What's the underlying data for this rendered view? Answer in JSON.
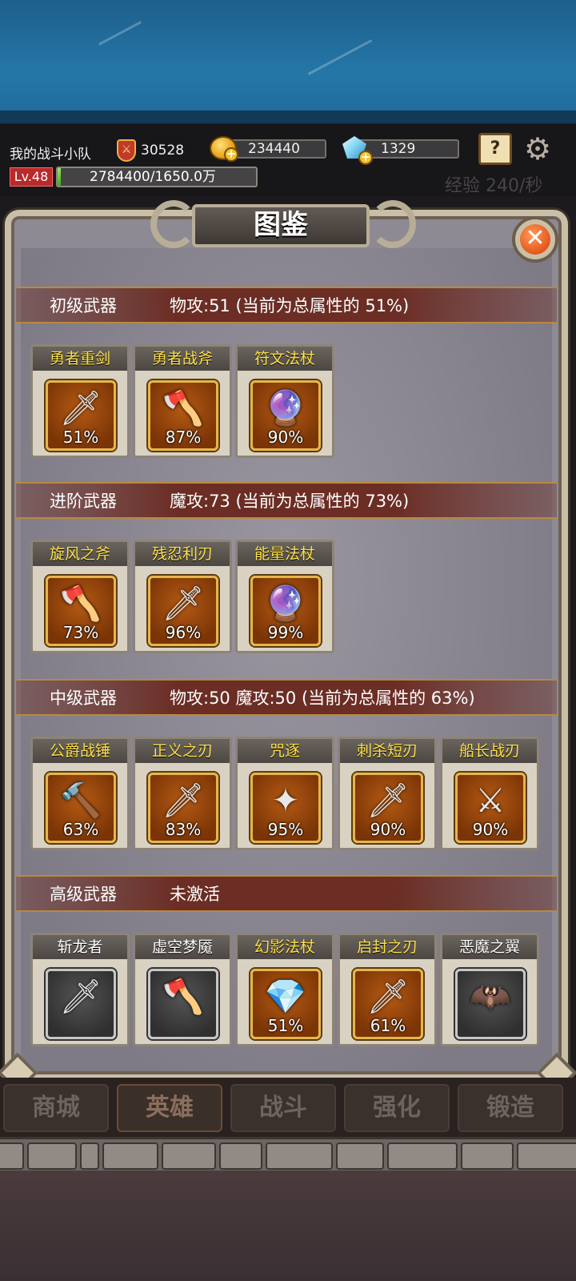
{
  "header": {
    "team_name": "我的战斗小队",
    "power": "30528",
    "gold": "234440",
    "diamonds": "1329",
    "level": "Lv.48",
    "xp_text": "2784400/1650.0万",
    "xp_fill_fraction": 0.017,
    "xp_rate": "经验 240/秒",
    "icons": {
      "power": "sword-shield-icon",
      "gold": "gold-coin-icon",
      "diamond": "diamond-icon",
      "guide": "help-book-icon",
      "settings": "gear-icon"
    }
  },
  "panel": {
    "title": "图鉴",
    "close_icon": "close-icon",
    "sections": [
      {
        "name": "初级武器",
        "stat": "物攻:51 (当前为总属性的 51%)",
        "items": [
          {
            "label": "勇者重剑",
            "pct": "51%",
            "icon": "greatsword-icon",
            "glyph": "🗡"
          },
          {
            "label": "勇者战斧",
            "pct": "87%",
            "icon": "battle-axe-icon",
            "glyph": "🪓"
          },
          {
            "label": "符文法杖",
            "pct": "90%",
            "icon": "rune-staff-icon",
            "glyph": "🔮"
          }
        ]
      },
      {
        "name": "进阶武器",
        "stat": "魔攻:73 (当前为总属性的 73%)",
        "items": [
          {
            "label": "旋风之斧",
            "pct": "73%",
            "icon": "whirlwind-axe-icon",
            "glyph": "🪓"
          },
          {
            "label": "残忍利刃",
            "pct": "96%",
            "icon": "cruel-blade-icon",
            "glyph": "🗡"
          },
          {
            "label": "能量法杖",
            "pct": "99%",
            "icon": "energy-staff-icon",
            "glyph": "🔮"
          }
        ]
      },
      {
        "name": "中级武器",
        "stat": "物攻:50  魔攻:50 (当前为总属性的 63%)",
        "items": [
          {
            "label": "公爵战锤",
            "pct": "63%",
            "icon": "war-hammer-icon",
            "glyph": "🔨"
          },
          {
            "label": "正义之刃",
            "pct": "83%",
            "icon": "justice-blade-icon",
            "glyph": "🗡"
          },
          {
            "label": "咒逐",
            "pct": "95%",
            "icon": "curse-staff-icon",
            "glyph": "✦"
          },
          {
            "label": "刺杀短刃",
            "pct": "90%",
            "icon": "assassin-dagger-icon",
            "glyph": "🗡"
          },
          {
            "label": "船长战刃",
            "pct": "90%",
            "icon": "captain-blade-icon",
            "glyph": "⚔"
          }
        ]
      },
      {
        "name": "高级武器",
        "stat": "未激活",
        "items": [
          {
            "label": "斩龙者",
            "pct": "",
            "icon": "dragon-slayer-icon",
            "glyph": "🗡",
            "locked": true
          },
          {
            "label": "虚空梦魇",
            "pct": "",
            "icon": "void-nightmare-icon",
            "glyph": "🪓",
            "locked": true
          },
          {
            "label": "幻影法杖",
            "pct": "51%",
            "icon": "phantom-staff-icon",
            "glyph": "💎"
          },
          {
            "label": "启封之刃",
            "pct": "61%",
            "icon": "unseal-blade-icon",
            "glyph": "🗡"
          },
          {
            "label": "恶魔之翼",
            "pct": "",
            "icon": "demon-wing-icon",
            "glyph": "🦇",
            "locked": true
          }
        ]
      }
    ]
  },
  "nav": {
    "tabs": [
      "商城",
      "英雄",
      "战斗",
      "强化",
      "锻造"
    ],
    "active_index": 1
  }
}
